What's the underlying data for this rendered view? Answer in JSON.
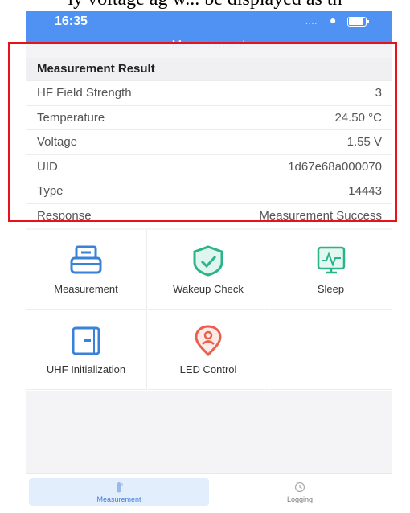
{
  "caption": "ly voltage ag w... be displayed as th",
  "status_bar": {
    "time": "16:35",
    "signal": "....",
    "wifi_icon": "wifi-icon",
    "battery_icon": "battery-icon"
  },
  "nav": {
    "title": "Measurement"
  },
  "results": {
    "header": "Measurement Result",
    "rows": [
      {
        "label": "HF Field Strength",
        "value": "3"
      },
      {
        "label": "Temperature",
        "value": "24.50 °C"
      },
      {
        "label": "Voltage",
        "value": "1.55 V"
      },
      {
        "label": "UID",
        "value": "1d67e68a000070"
      },
      {
        "label": "Type",
        "value": "14443"
      },
      {
        "label": "Response",
        "value": "Measurement Success"
      }
    ]
  },
  "functions": [
    {
      "label": "Measurement",
      "icon": "scanner-icon",
      "color": "#3a82d8"
    },
    {
      "label": "Wakeup Check",
      "icon": "shield-check-icon",
      "color": "#2bb38a"
    },
    {
      "label": "Sleep",
      "icon": "sleep-monitor-icon",
      "color": "#2bb38a"
    },
    {
      "label": "UHF Initialization",
      "icon": "card-reader-icon",
      "color": "#3a82d8"
    },
    {
      "label": "LED Control",
      "icon": "location-pin-icon",
      "color": "#e8604c"
    }
  ],
  "tabbar": {
    "tabs": [
      {
        "label": "Measurement",
        "icon": "thermometer-icon",
        "active": true
      },
      {
        "label": "Logging",
        "icon": "clock-icon",
        "active": false
      }
    ]
  },
  "colors": {
    "accent": "#4f92f4",
    "highlight_box": "#e8121a",
    "green": "#2bb38a",
    "red": "#e8604c"
  }
}
